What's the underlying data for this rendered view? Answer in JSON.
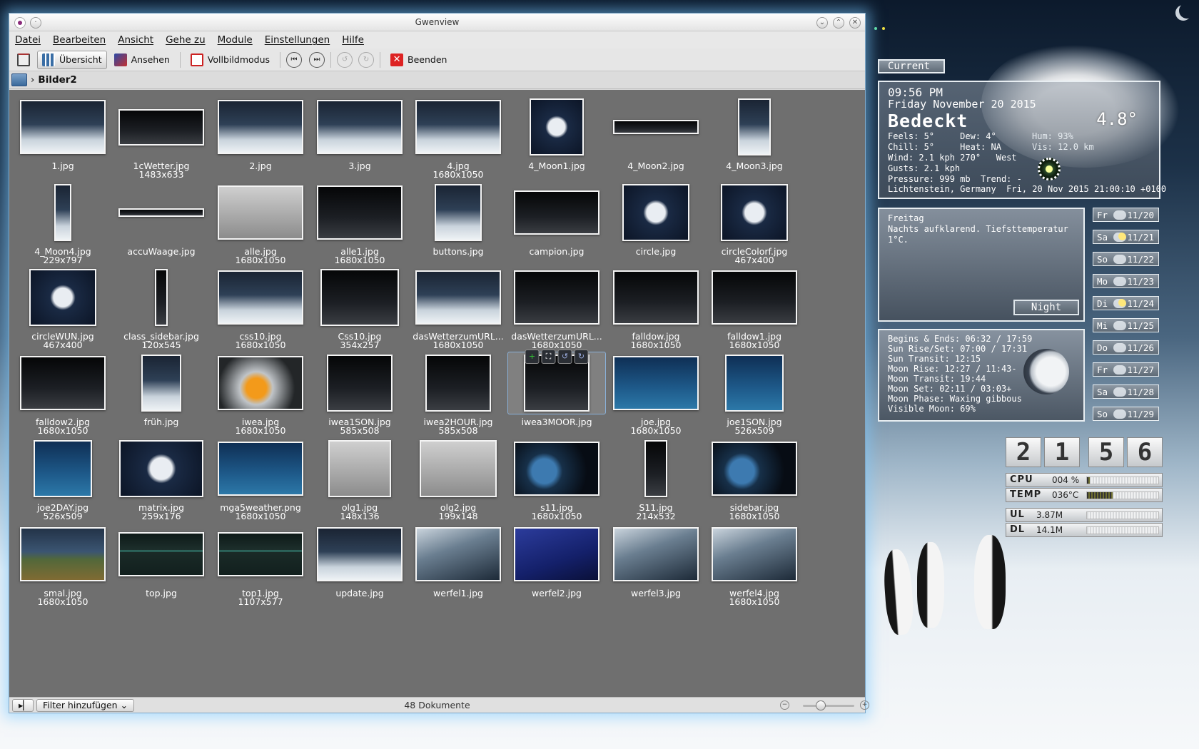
{
  "window": {
    "title": "Gwenview",
    "menu": [
      "Datei",
      "Bearbeiten",
      "Ansicht",
      "Gehe zu",
      "Module",
      "Einstellungen",
      "Hilfe"
    ],
    "toolbar": {
      "overview": "Übersicht",
      "view": "Ansehen",
      "fullscreen": "Vollbildmodus",
      "quit": "Beenden"
    },
    "breadcrumb": "Bilder2",
    "status": {
      "filter": "Filter hinzufügen",
      "count": "48 Dokumente",
      "zoom_level": 0.35
    }
  },
  "grid": {
    "items": [
      {
        "name": "1.jpg",
        "dim": "",
        "style": "",
        "w": 120,
        "h": 76
      },
      {
        "name": "1cWetter.jpg",
        "dim": "1483x633",
        "style": "dark",
        "w": 120,
        "h": 51
      },
      {
        "name": "2.jpg",
        "dim": "",
        "style": "",
        "w": 120,
        "h": 76
      },
      {
        "name": "3.jpg",
        "dim": "",
        "style": "",
        "w": 120,
        "h": 76
      },
      {
        "name": "4.jpg",
        "dim": "1680x1050",
        "style": "",
        "w": 120,
        "h": 76
      },
      {
        "name": "4_Moon1.jpg",
        "dim": "",
        "style": "navy",
        "w": 76,
        "h": 80
      },
      {
        "name": "4_Moon2.jpg",
        "dim": "",
        "style": "dark",
        "w": 120,
        "h": 20
      },
      {
        "name": "4_Moon3.jpg",
        "dim": "",
        "style": "",
        "w": 46,
        "h": 80
      },
      {
        "name": "4_Moon4.jpg",
        "dim": "229x797",
        "style": "",
        "w": 24,
        "h": 80
      },
      {
        "name": "accuWaage.jpg",
        "dim": "",
        "style": "dark",
        "w": 120,
        "h": 12
      },
      {
        "name": "alle.jpg",
        "dim": "1680x1050",
        "style": "gray",
        "w": 120,
        "h": 76
      },
      {
        "name": "alle1.jpg",
        "dim": "1680x1050",
        "style": "dark",
        "w": 120,
        "h": 76
      },
      {
        "name": "buttons.jpg",
        "dim": "",
        "style": "",
        "w": 66,
        "h": 80
      },
      {
        "name": "campion.jpg",
        "dim": "",
        "style": "dark",
        "w": 120,
        "h": 62
      },
      {
        "name": "circle.jpg",
        "dim": "",
        "style": "navy",
        "w": 94,
        "h": 80
      },
      {
        "name": "circleColorf.jpg",
        "dim": "467x400",
        "style": "navy",
        "w": 94,
        "h": 80
      },
      {
        "name": "circleWUN.jpg",
        "dim": "467x400",
        "style": "navy",
        "w": 94,
        "h": 80
      },
      {
        "name": "class_sidebar.jpg",
        "dim": "120x545",
        "style": "dark",
        "w": 18,
        "h": 80
      },
      {
        "name": "css10.jpg",
        "dim": "1680x1050",
        "style": "",
        "w": 120,
        "h": 76
      },
      {
        "name": "Css10.jpg",
        "dim": "354x257",
        "style": "dark",
        "w": 110,
        "h": 80
      },
      {
        "name": "dasWetterzumURL...",
        "dim": "1680x1050",
        "style": "",
        "w": 120,
        "h": 76
      },
      {
        "name": "dasWetterzumURL...",
        "dim": "1680x1050",
        "style": "dark",
        "w": 120,
        "h": 76
      },
      {
        "name": "falldow.jpg",
        "dim": "1680x1050",
        "style": "dark",
        "w": 120,
        "h": 76
      },
      {
        "name": "falldow1.jpg",
        "dim": "1680x1050",
        "style": "dark",
        "w": 120,
        "h": 76
      },
      {
        "name": "falldow2.jpg",
        "dim": "1680x1050",
        "style": "dark",
        "w": 120,
        "h": 76
      },
      {
        "name": "früh.jpg",
        "dim": "",
        "style": "",
        "w": 56,
        "h": 80
      },
      {
        "name": "iwea.jpg",
        "dim": "1680x1050",
        "style": "orange",
        "w": 120,
        "h": 76
      },
      {
        "name": "iwea1SON.jpg",
        "dim": "585x508",
        "style": "dark",
        "w": 92,
        "h": 80
      },
      {
        "name": "iwea2HOUR.jpg",
        "dim": "585x508",
        "style": "dark",
        "w": 92,
        "h": 80
      },
      {
        "name": "iwea3MOOR.jpg",
        "dim": "",
        "style": "dark",
        "w": 92,
        "h": 80,
        "hover": true
      },
      {
        "name": "joe.jpg",
        "dim": "1680x1050",
        "style": "blue",
        "w": 120,
        "h": 76
      },
      {
        "name": "joe1SON.jpg",
        "dim": "526x509",
        "style": "blue",
        "w": 82,
        "h": 80
      },
      {
        "name": "joe2DAY.jpg",
        "dim": "526x509",
        "style": "blue",
        "w": 82,
        "h": 80
      },
      {
        "name": "matrix.jpg",
        "dim": "259x176",
        "style": "navy",
        "w": 118,
        "h": 80
      },
      {
        "name": "mga5weather.png",
        "dim": "1680x1050",
        "style": "blue",
        "w": 120,
        "h": 76
      },
      {
        "name": "olg1.jpg",
        "dim": "148x136",
        "style": "gray",
        "w": 88,
        "h": 80
      },
      {
        "name": "olg2.jpg",
        "dim": "199x148",
        "style": "gray",
        "w": 108,
        "h": 80
      },
      {
        "name": "s11.jpg",
        "dim": "1680x1050",
        "style": "earth",
        "w": 120,
        "h": 76
      },
      {
        "name": "S11.jpg",
        "dim": "214x532",
        "style": "dark",
        "w": 32,
        "h": 80
      },
      {
        "name": "sidebar.jpg",
        "dim": "1680x1050",
        "style": "earth",
        "w": 120,
        "h": 76
      },
      {
        "name": "smal.jpg",
        "dim": "1680x1050",
        "style": "land",
        "w": 120,
        "h": 76
      },
      {
        "name": "top.jpg",
        "dim": "",
        "style": "green",
        "w": 120,
        "h": 62
      },
      {
        "name": "top1.jpg",
        "dim": "1107x577",
        "style": "green",
        "w": 120,
        "h": 62
      },
      {
        "name": "update.jpg",
        "dim": "",
        "style": "",
        "w": 120,
        "h": 76
      },
      {
        "name": "werfel1.jpg",
        "dim": "",
        "style": "cube",
        "w": 120,
        "h": 76
      },
      {
        "name": "werfel2.jpg",
        "dim": "",
        "style": "cubeblue",
        "w": 120,
        "h": 76
      },
      {
        "name": "werfel3.jpg",
        "dim": "",
        "style": "cube",
        "w": 120,
        "h": 76
      },
      {
        "name": "werfel4.jpg",
        "dim": "1680x1050",
        "style": "cube",
        "w": 120,
        "h": 76
      }
    ]
  },
  "weather": {
    "label": "Current",
    "time": "09:56 PM",
    "date": "Friday November 20 2015",
    "condition": "Bedeckt",
    "temp": "4.8°",
    "feels": "Feels: 5°     Dew: 4°",
    "chill": "Chill: 5°     Heat: NA",
    "wind": "Wind: 2.1 kph 270°   West",
    "gusts": "Gusts: 2.1 kph",
    "pressure": "Pressure: 999 mb  Trend: -",
    "hum": "Hum: 93%",
    "vis": "Vis: 12.0 km",
    "location": "Lichtenstein, Germany  Fri, 20 Nov 2015 21:00:10 +0100",
    "day": "Freitag",
    "desc": "Nachts aufklarend. Tiefsttemperatur 1°C.",
    "night": "Night",
    "astro": [
      "Begins & Ends: 06:32 / 17:59",
      "Sun Rise/Set: 07:00 / 17:31",
      "Sun Transit: 12:15",
      "Moon Rise: 12:27 / 11:43-",
      "Moon Transit: 19:44",
      "Moon Set: 02:11 / 03:03+",
      "Moon Phase: Waxing gibbous",
      "Visible Moon: 69%"
    ],
    "forecast": [
      {
        "day": "Fr",
        "date": "11/20",
        "icon": "cloud-icon"
      },
      {
        "day": "Sa",
        "date": "11/21",
        "icon": "sun-cloud-icon"
      },
      {
        "day": "So",
        "date": "11/22",
        "icon": "cloud-icon"
      },
      {
        "day": "Mo",
        "date": "11/23",
        "icon": "cloud-icon"
      },
      {
        "day": "Di",
        "date": "11/24",
        "icon": "sun-cloud-icon"
      },
      {
        "day": "Mi",
        "date": "11/25",
        "icon": "cloud-icon"
      },
      {
        "day": "Do",
        "date": "11/26",
        "icon": "cloud-icon"
      },
      {
        "day": "Fr",
        "date": "11/27",
        "icon": "cloud-icon"
      },
      {
        "day": "Sa",
        "date": "11/28",
        "icon": "cloud-icon"
      },
      {
        "day": "So",
        "date": "11/29",
        "icon": "cloud-icon"
      }
    ]
  },
  "sysmon": {
    "clock": [
      "2",
      "1",
      "5",
      "6"
    ],
    "cpu_label": "CPU",
    "cpu": "004 %",
    "cpu_level": 0.04,
    "temp_label": "TEMP",
    "temp": "036°C",
    "temp_level": 0.36,
    "ul_label": "UL",
    "ul": "3.87M",
    "ul_level": 0,
    "dl_label": "DL",
    "dl": "14.1M",
    "dl_level": 0
  }
}
